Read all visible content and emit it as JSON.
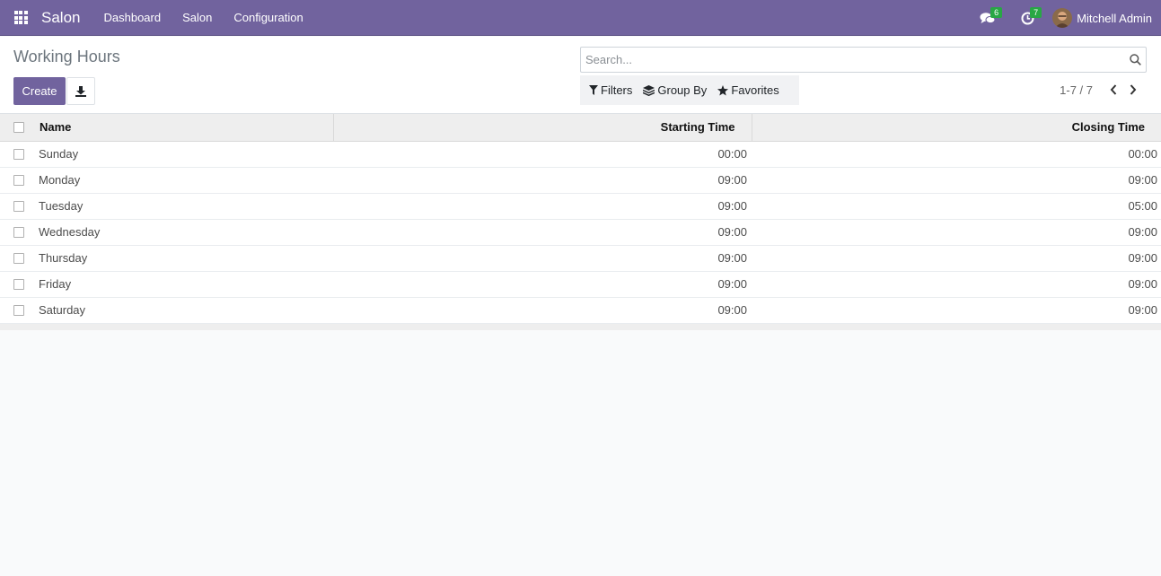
{
  "navbar": {
    "brand": "Salon",
    "menu": [
      "Dashboard",
      "Salon",
      "Configuration"
    ],
    "messages_count": "6",
    "activities_count": "7",
    "user_name": "Mitchell Admin"
  },
  "control_panel": {
    "title": "Working Hours",
    "create_label": "Create",
    "search_placeholder": "Search...",
    "filters_label": "Filters",
    "groupby_label": "Group By",
    "favorites_label": "Favorites",
    "pager_value": "1-7 / 7"
  },
  "table": {
    "columns": [
      "Name",
      "Starting Time",
      "Closing Time"
    ],
    "rows": [
      {
        "name": "Sunday",
        "start": "00:00",
        "close": "00:00"
      },
      {
        "name": "Monday",
        "start": "09:00",
        "close": "09:00"
      },
      {
        "name": "Tuesday",
        "start": "09:00",
        "close": "05:00"
      },
      {
        "name": "Wednesday",
        "start": "09:00",
        "close": "09:00"
      },
      {
        "name": "Thursday",
        "start": "09:00",
        "close": "09:00"
      },
      {
        "name": "Friday",
        "start": "09:00",
        "close": "09:00"
      },
      {
        "name": "Saturday",
        "start": "09:00",
        "close": "09:00"
      }
    ]
  },
  "colors": {
    "brand_purple": "#71639e",
    "badge_green": "#28a745"
  },
  "icons": {
    "apps": "apps-grid-icon",
    "messages": "comments-icon",
    "activities": "clock-icon",
    "download": "download-icon",
    "search": "search-icon",
    "filter": "filter-icon",
    "groupby": "layers-icon",
    "favorites": "star-icon",
    "prev": "chevron-left-icon",
    "next": "chevron-right-icon"
  }
}
